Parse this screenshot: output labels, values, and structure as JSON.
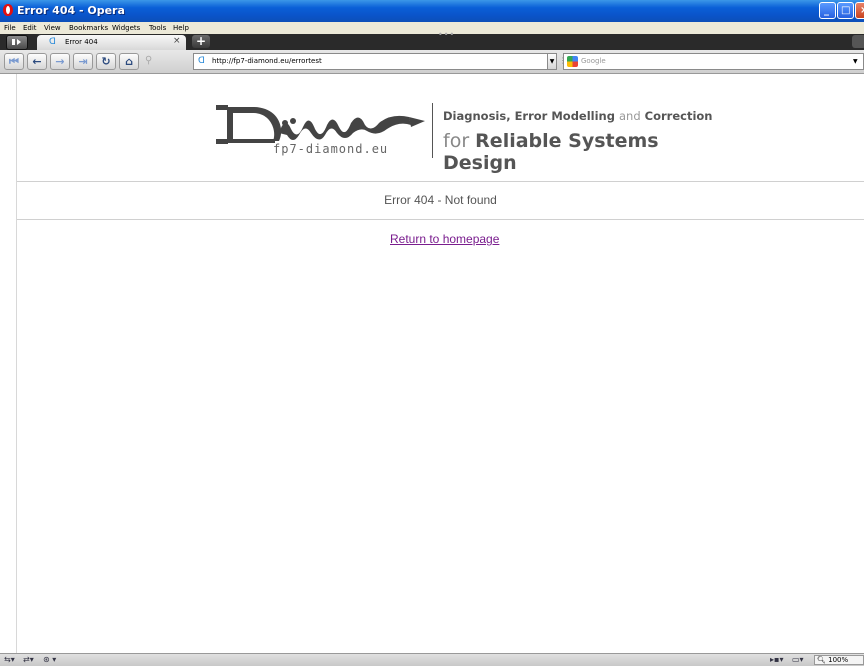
{
  "window": {
    "title": "Error 404 - Opera",
    "minimize_icon": "minimize-icon",
    "maximize_icon": "maximize-icon",
    "close_icon": "close-icon"
  },
  "menu": [
    "File",
    "Edit",
    "View",
    "Bookmarks",
    "Widgets",
    "Tools",
    "Help"
  ],
  "tab": {
    "title": "Error 404",
    "close_glyph": "×",
    "new_tab_glyph": "+"
  },
  "address_bar": {
    "url": "http://fp7-diamond.eu/errortest"
  },
  "search": {
    "placeholder": "Google"
  },
  "page": {
    "brand": {
      "tagline_line1_part1": "Diagnosis, Error Modelling",
      "tagline_line1_part2": "and",
      "tagline_line1_part3": "Correction",
      "tagline_line2_part1": "for",
      "tagline_line2_part2": "Reliable Systems Design",
      "logo_domain": "fp7-diamond.eu"
    },
    "error_message": "Error 404 - Not found",
    "home_link": "Return to homepage"
  },
  "status_bar": {
    "zoom": "100%"
  },
  "colors": {
    "title_bar": "#0a5fd8",
    "link_visited": "#7a1d8e",
    "error_text": "#555555"
  }
}
